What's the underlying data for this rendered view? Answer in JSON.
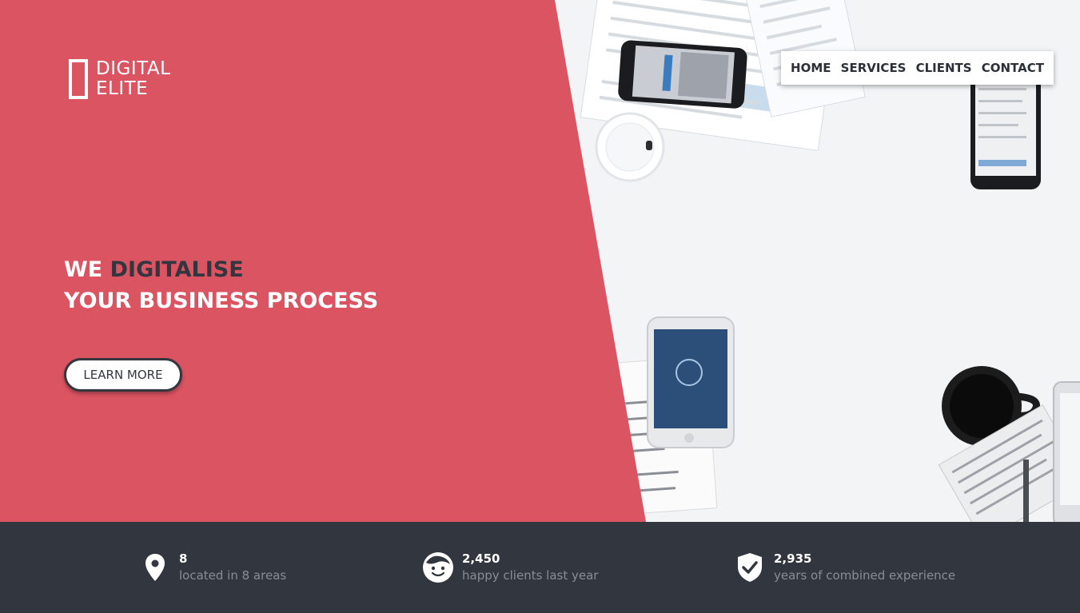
{
  "brand": {
    "line1": "DIGITAL",
    "line2": "ELITE"
  },
  "nav": {
    "items": [
      "HOME",
      "SERVICES",
      "CLIENTS",
      "CONTACT"
    ]
  },
  "hero": {
    "headline_we": "WE",
    "headline_accent": "DIGITALISE",
    "headline_line2": "YOUR BUSINESS PROCESS",
    "cta_label": "LEARN MORE"
  },
  "stats": [
    {
      "icon": "map-pin-icon",
      "number": "8",
      "label": "located in 8 areas"
    },
    {
      "icon": "smiley-face-icon",
      "number": "2,450",
      "label": "happy clients last year"
    },
    {
      "icon": "shield-check-icon",
      "number": "2,935",
      "label": "years of combined experience"
    }
  ],
  "colors": {
    "accent": "#db5462",
    "dark": "#32363f",
    "text_dark": "#33363f"
  }
}
